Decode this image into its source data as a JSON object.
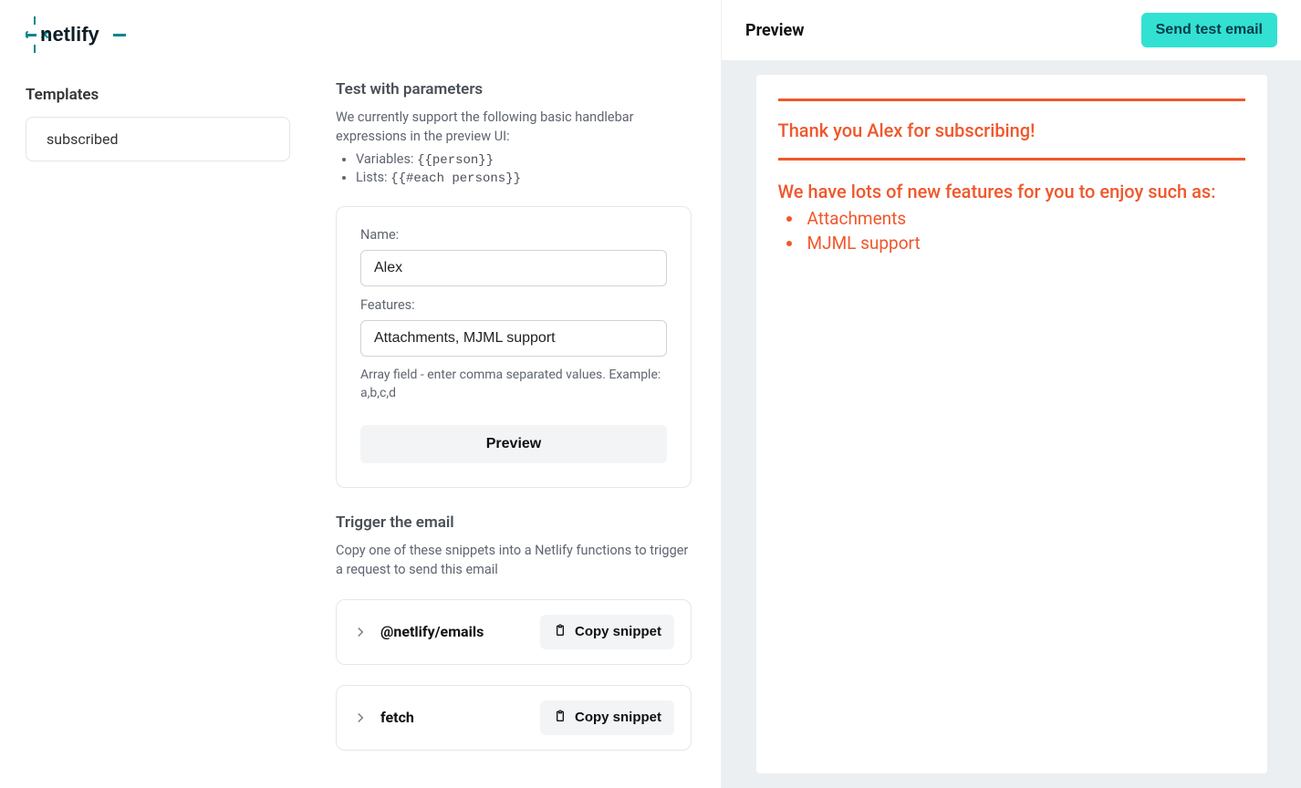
{
  "sidebar": {
    "templates_heading": "Templates",
    "items": [
      {
        "name": "subscribed"
      }
    ]
  },
  "test": {
    "heading": "Test with parameters",
    "description": "We currently support the following basic handlebar expressions in the preview UI:",
    "expressions": {
      "variables_label": "Variables:",
      "variables_code": "{{person}}",
      "lists_label": "Lists:",
      "lists_code": "{{#each persons}}"
    },
    "fields": {
      "name_label": "Name:",
      "name_value": "Alex",
      "features_label": "Features:",
      "features_value": "Attachments, MJML support"
    },
    "help": "Array field - enter comma separated values. Example: a,b,c,d",
    "preview_button": "Preview"
  },
  "trigger": {
    "heading": "Trigger the email",
    "description": "Copy one of these snippets into a Netlify functions to trigger a request to send this email",
    "snippets": [
      {
        "name": "@netlify/emails",
        "copy_label": "Copy snippet"
      },
      {
        "name": "fetch",
        "copy_label": "Copy snippet"
      }
    ]
  },
  "preview": {
    "title": "Preview",
    "send_button": "Send test email",
    "email": {
      "greeting": "Thank you Alex for subscribing!",
      "subhead": "We have lots of new features for you to enjoy such as:",
      "features": [
        "Attachments",
        "MJML support"
      ]
    }
  }
}
